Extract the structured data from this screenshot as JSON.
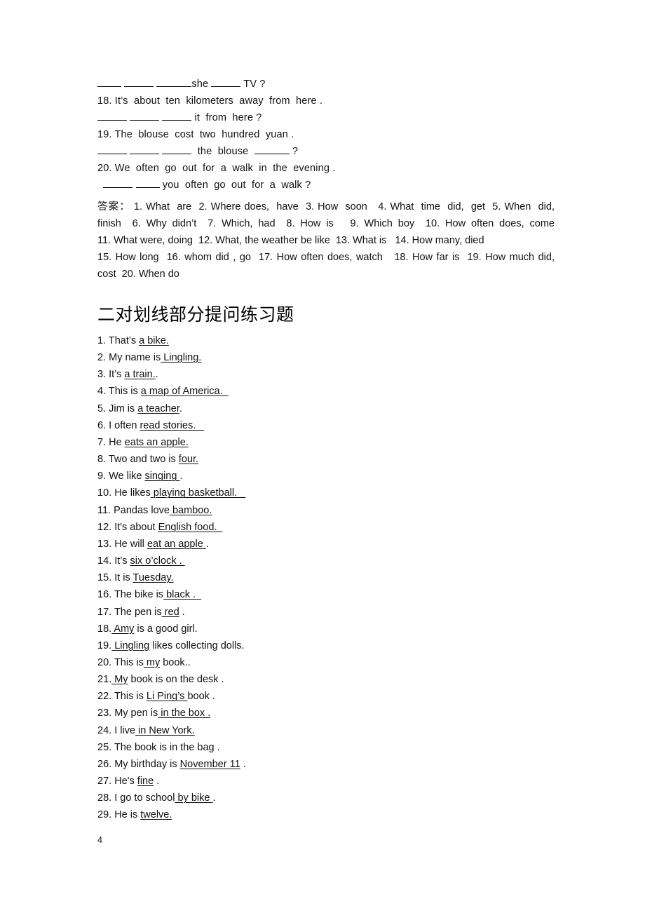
{
  "page": {
    "number": "4",
    "background_color": "#ffffff",
    "text_color": "#111111"
  },
  "top_exercise": {
    "lines": [
      {
        "kind": "blanks",
        "segments": [
          {
            "type": "blank",
            "size": "sm"
          },
          {
            "type": "text",
            "value": " "
          },
          {
            "type": "blank",
            "size": "md"
          },
          {
            "type": "text",
            "value": " "
          },
          {
            "type": "blank",
            "size": "lg"
          },
          {
            "type": "text",
            "value": "she "
          },
          {
            "type": "blank",
            "size": "md"
          },
          {
            "type": "text",
            "value": " TV ?"
          }
        ]
      },
      {
        "kind": "prompt",
        "text": "18. It’s  about  ten  kilometers  away  from  here ."
      },
      {
        "kind": "blanks",
        "segments": [
          {
            "type": "blank",
            "size": "md"
          },
          {
            "type": "text",
            "value": " "
          },
          {
            "type": "blank",
            "size": "md"
          },
          {
            "type": "text",
            "value": " "
          },
          {
            "type": "blank",
            "size": "md"
          },
          {
            "type": "text",
            "value": " it  from  here ?"
          }
        ]
      },
      {
        "kind": "prompt",
        "text": "19. The  blouse  cost  two  hundred  yuan ."
      },
      {
        "kind": "blanks",
        "segments": [
          {
            "type": "blank",
            "size": "md"
          },
          {
            "type": "text",
            "value": " "
          },
          {
            "type": "blank",
            "size": "md"
          },
          {
            "type": "text",
            "value": " "
          },
          {
            "type": "blank",
            "size": "md"
          },
          {
            "type": "text",
            "value": "  the  blouse  "
          },
          {
            "type": "blank",
            "size": "lg"
          },
          {
            "type": "text",
            "value": " ?"
          }
        ]
      },
      {
        "kind": "prompt",
        "text": "20. We  often  go  out  for  a  walk  in  the  evening ."
      },
      {
        "kind": "blanks",
        "segments": [
          {
            "type": "text",
            "value": "  "
          },
          {
            "type": "blank",
            "size": "md"
          },
          {
            "type": "text",
            "value": " "
          },
          {
            "type": "blank",
            "size": "sm"
          },
          {
            "type": "text",
            "value": " you  often  go  out  for  a  walk ?"
          }
        ]
      }
    ]
  },
  "answer_key": {
    "label": "答案：",
    "lines": [
      "答案： 1. What  are  2. Where does,  have  3. How  soon   4. What  time  did,  get  5. When  did,",
      "finish  6. Why didn’t  7. Which, had  8. How is   9. Which boy  10. How often does, come",
      "11. What were, doing  12. What, the weather be like  13. What is   14. How many, died",
      "15. How long  16. whom did , go  17. How often does, watch   18. How far is  19. How much did,",
      "cost  20. When do"
    ],
    "justified_flags": [
      true,
      true,
      false,
      true,
      false
    ]
  },
  "section_heading": "二对划线部分提问练习题",
  "practice_items": [
    {
      "num": "1.",
      "parts": [
        {
          "t": " That’s ",
          "u": false
        },
        {
          "t": "a bike.",
          "u": true
        }
      ]
    },
    {
      "num": "2.",
      "parts": [
        {
          "t": " My name is",
          "u": false
        },
        {
          "t": " Lingling.",
          "u": true
        }
      ]
    },
    {
      "num": "3.",
      "parts": [
        {
          "t": " It’s ",
          "u": false
        },
        {
          "t": "a train.",
          "u": true
        },
        {
          "t": ".",
          "u": false
        }
      ]
    },
    {
      "num": "4.",
      "parts": [
        {
          "t": " This is ",
          "u": false
        },
        {
          "t": "a map of America.  ",
          "u": true
        }
      ]
    },
    {
      "num": "5.",
      "parts": [
        {
          "t": " Jim is ",
          "u": false
        },
        {
          "t": "a teacher",
          "u": true
        },
        {
          "t": ".",
          "u": false
        }
      ]
    },
    {
      "num": "6.",
      "parts": [
        {
          "t": " I often ",
          "u": false
        },
        {
          "t": "read stories.   ",
          "u": true
        }
      ]
    },
    {
      "num": "7.",
      "parts": [
        {
          "t": " He ",
          "u": false
        },
        {
          "t": "eats an apple.",
          "u": true
        }
      ]
    },
    {
      "num": "8.",
      "parts": [
        {
          "t": " Two and two is ",
          "u": false
        },
        {
          "t": "four.",
          "u": true
        }
      ]
    },
    {
      "num": "9.",
      "parts": [
        {
          "t": " We like ",
          "u": false
        },
        {
          "t": "singing ",
          "u": true
        },
        {
          "t": ".",
          "u": false
        }
      ]
    },
    {
      "num": "10.",
      "parts": [
        {
          "t": " He likes",
          "u": false
        },
        {
          "t": " playing basketball.   ",
          "u": true
        }
      ]
    },
    {
      "num": "11.",
      "parts": [
        {
          "t": " Pandas love",
          "u": false
        },
        {
          "t": " bamboo.",
          "u": true
        }
      ]
    },
    {
      "num": "12.",
      "parts": [
        {
          "t": " It's about ",
          "u": false
        },
        {
          "t": "English food.  ",
          "u": true
        }
      ]
    },
    {
      "num": "13.",
      "parts": [
        {
          "t": " He will ",
          "u": false
        },
        {
          "t": "eat an apple ",
          "u": true
        },
        {
          "t": ".",
          "u": false
        }
      ]
    },
    {
      "num": "14.",
      "parts": [
        {
          "t": " It’s ",
          "u": false
        },
        {
          "t": "six o’clock . ",
          "u": true
        }
      ]
    },
    {
      "num": "15.",
      "parts": [
        {
          "t": " It is ",
          "u": false
        },
        {
          "t": "Tuesday.",
          "u": true
        }
      ]
    },
    {
      "num": "16.",
      "parts": [
        {
          "t": " The bike is",
          "u": false
        },
        {
          "t": " black .  ",
          "u": true
        }
      ]
    },
    {
      "num": "17.",
      "parts": [
        {
          "t": " The pen is",
          "u": false
        },
        {
          "t": " red",
          "u": true
        },
        {
          "t": " .",
          "u": false
        }
      ]
    },
    {
      "num": "18.",
      "parts": [
        {
          "t": " Amy",
          "u": true
        },
        {
          "t": " is a good girl.",
          "u": false
        }
      ]
    },
    {
      "num": "19.",
      "parts": [
        {
          "t": " Lingling",
          "u": true
        },
        {
          "t": " likes collecting dolls.",
          "u": false
        }
      ]
    },
    {
      "num": "20.",
      "parts": [
        {
          "t": " This is",
          "u": false
        },
        {
          "t": " my",
          "u": true
        },
        {
          "t": " book..",
          "u": false
        }
      ]
    },
    {
      "num": "21.",
      "parts": [
        {
          "t": " My",
          "u": true
        },
        {
          "t": " book is on the desk .",
          "u": false
        }
      ]
    },
    {
      "num": "22.",
      "parts": [
        {
          "t": " This is ",
          "u": false
        },
        {
          "t": "Li Ping’s ",
          "u": true
        },
        {
          "t": "book .",
          "u": false
        }
      ]
    },
    {
      "num": "23.",
      "parts": [
        {
          "t": " My pen is",
          "u": false
        },
        {
          "t": " in the box .",
          "u": true
        }
      ]
    },
    {
      "num": "24.",
      "parts": [
        {
          "t": " I live",
          "u": false
        },
        {
          "t": " in New York.",
          "u": true
        }
      ]
    },
    {
      "num": "25.",
      "parts": [
        {
          "t": " The book is in the bag .",
          "u": false
        }
      ]
    },
    {
      "num": "26.",
      "parts": [
        {
          "t": " My birthday is ",
          "u": false
        },
        {
          "t": "November 11",
          "u": true
        },
        {
          "t": " .",
          "u": false
        }
      ]
    },
    {
      "num": "27.",
      "parts": [
        {
          "t": " He's ",
          "u": false
        },
        {
          "t": "fine",
          "u": true
        },
        {
          "t": " .",
          "u": false
        }
      ]
    },
    {
      "num": "28.",
      "parts": [
        {
          "t": " I go to school",
          "u": false
        },
        {
          "t": " by bike ",
          "u": true
        },
        {
          "t": ".",
          "u": false
        }
      ]
    },
    {
      "num": "29.",
      "parts": [
        {
          "t": " He is ",
          "u": false
        },
        {
          "t": "twelve.",
          "u": true
        }
      ]
    }
  ]
}
